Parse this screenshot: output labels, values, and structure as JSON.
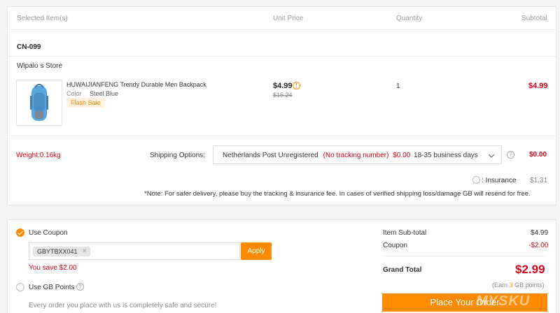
{
  "table_header": {
    "selected": "Selected Item(s)",
    "unit_price": "Unit Price",
    "quantity": "Quantity",
    "subtotal": "Subtotal"
  },
  "warehouse": "CN-099",
  "store_name": "Wipalo s Store",
  "item": {
    "name": "HUWAIJIANFENG Trendy Durable Men Backpack",
    "color_label": "Color",
    "color_value": "Steel Blue",
    "badge": "Flash Sale",
    "price": "$4.99",
    "original_price": "$15.24",
    "quantity": "1",
    "subtotal": "$4.99"
  },
  "shipping": {
    "weight": "Weight:0.16kg",
    "options_label": "Shipping Options:",
    "method": "Netherlands Post Unregistered",
    "tracking": "(No tracking number)",
    "cost": "$0.00",
    "days": "18-35 business days",
    "total": "$0.00",
    "insurance_label": ": Insurance",
    "insurance_price": "$1.31",
    "note": "*Note: For safer delivery, please buy the tracking & insurance fee. In cases of verified shipping loss/damage GB will resend for free."
  },
  "coupon": {
    "label": "Use Coupon",
    "code": "GBYTBXX041",
    "apply": "Apply",
    "savings": "You save $2.00",
    "gb_points": "Use GB Points",
    "safe_text": "Every order you place with us is completely safe and secure!"
  },
  "summary": {
    "subtotal_label": "Item Sub-total",
    "subtotal_value": "$4.99",
    "coupon_label": "Coupon",
    "coupon_value": "-$2.00",
    "grand_total_label": "Grand Total",
    "grand_total_value": "$2.99",
    "points_prefix": "(Earn",
    "points_num": "3",
    "points_suffix": "GB points)",
    "place_order": "Place Your Order"
  },
  "watermark": "MYSKU",
  "colors": {
    "accent": "#ff8a00",
    "price_red": "#d0021b"
  }
}
